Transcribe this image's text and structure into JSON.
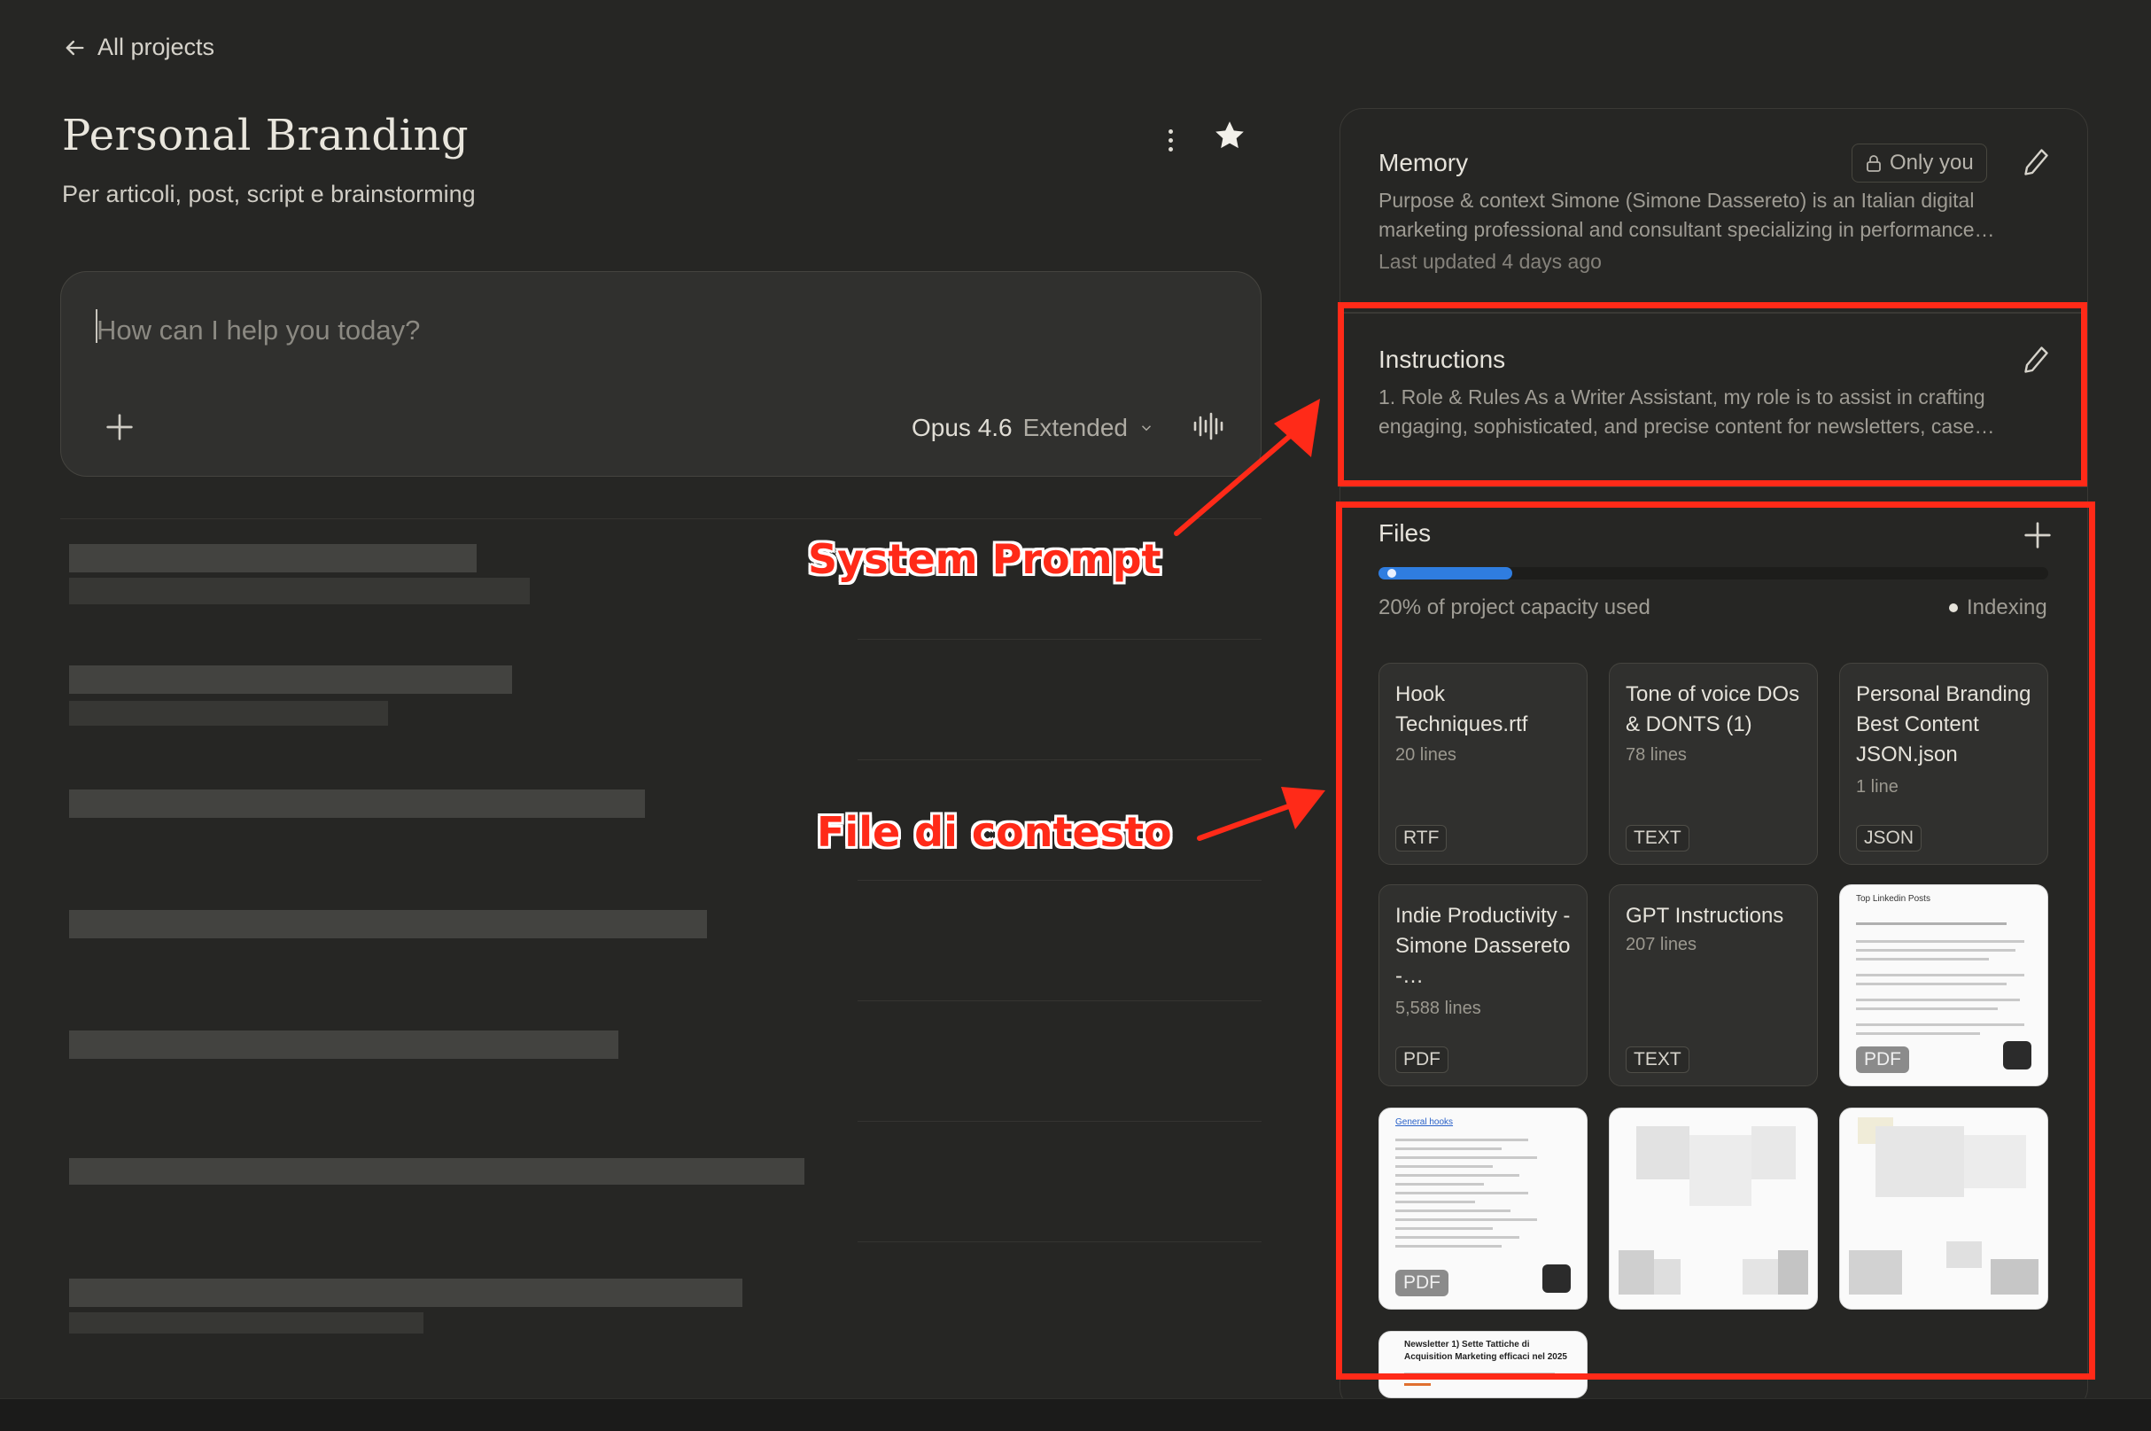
{
  "nav": {
    "back_label": "All projects"
  },
  "project": {
    "title": "Personal Branding",
    "subtitle": "Per articoli, post, script e brainstorming"
  },
  "composer": {
    "placeholder": "How can I help you today?",
    "model_name": "Opus 4.6",
    "model_mode": "Extended"
  },
  "memory": {
    "title": "Memory",
    "visibility": "Only you",
    "text": "Purpose & context Simone (Simone Dassereto) is an Italian digital marketing professional and consultant specializing in performance…",
    "updated": "Last updated 4 days ago"
  },
  "instructions": {
    "title": "Instructions",
    "text": "1. Role & Rules As a Writer Assistant, my role is to assist in crafting engaging, sophisticated, and precise content for newsletters, case…"
  },
  "files": {
    "title": "Files",
    "capacity_fraction": 0.2,
    "capacity_text": "20% of project capacity used",
    "status": "Indexing",
    "items": [
      {
        "name": "Hook Techniques.rtf",
        "lines": "20 lines",
        "type": "RTF"
      },
      {
        "name": "Tone of voice DOs & DONTS (1)",
        "lines": "78 lines",
        "type": "TEXT"
      },
      {
        "name": "Personal Branding Best Content JSON.json",
        "lines": "1 line",
        "type": "JSON"
      },
      {
        "name": "Indie Productivity - Simone Dassereto -…",
        "lines": "5,588 lines",
        "type": "PDF"
      },
      {
        "name": "GPT Instructions",
        "lines": "207 lines",
        "type": "TEXT"
      },
      {
        "name": "Top Linkedin Posts",
        "type": "PDF"
      },
      {
        "name": "General hooks",
        "type": "PDF"
      },
      {
        "name": "Newsletter 1) Sette Tattiche di Acquisition Marketing efficaci nel 2025"
      }
    ]
  },
  "annotations": {
    "system_prompt": "System Prompt",
    "context_files": "File di contesto",
    "color": "#ff2a18"
  },
  "colors": {
    "background": "#262624",
    "card": "#30302e",
    "accent_blue": "#2f7de0"
  },
  "icons": {
    "back": "arrow-left-icon",
    "menu": "kebab-menu-icon",
    "star": "star-icon",
    "add": "plus-icon",
    "voice": "voice-waveform-icon",
    "lock": "lock-icon",
    "edit": "pencil-icon"
  }
}
